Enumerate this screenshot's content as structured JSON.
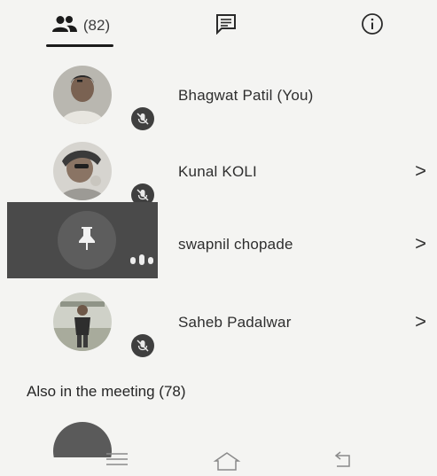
{
  "tabs": {
    "people": {
      "icon": "people-icon",
      "count": "(82)"
    },
    "chat": {
      "icon": "chat-icon"
    },
    "info": {
      "icon": "info-icon"
    }
  },
  "participants": [
    {
      "name": "Bhagwat Patil (You)",
      "mic": "mic-off-icon",
      "has_chevron": false
    },
    {
      "name": "Kunal KOLI",
      "mic": "mic-off-icon",
      "has_chevron": true,
      "chevron": ">"
    },
    {
      "name": "swapnil chopade",
      "mic": "speaking-icon",
      "has_chevron": true,
      "chevron": ">"
    },
    {
      "name": "Saheb Padalwar",
      "mic": "mic-off-icon",
      "has_chevron": true,
      "chevron": ">"
    }
  ],
  "also_in_meeting": "Also in the meeting (78)",
  "nav": {
    "menu": "menu-icon",
    "home": "home-icon",
    "back": "back-icon"
  },
  "colors": {
    "background": "#f4f4f2",
    "dark_tile": "#4a4a4a",
    "mic_badge": "#3f3f3f"
  }
}
